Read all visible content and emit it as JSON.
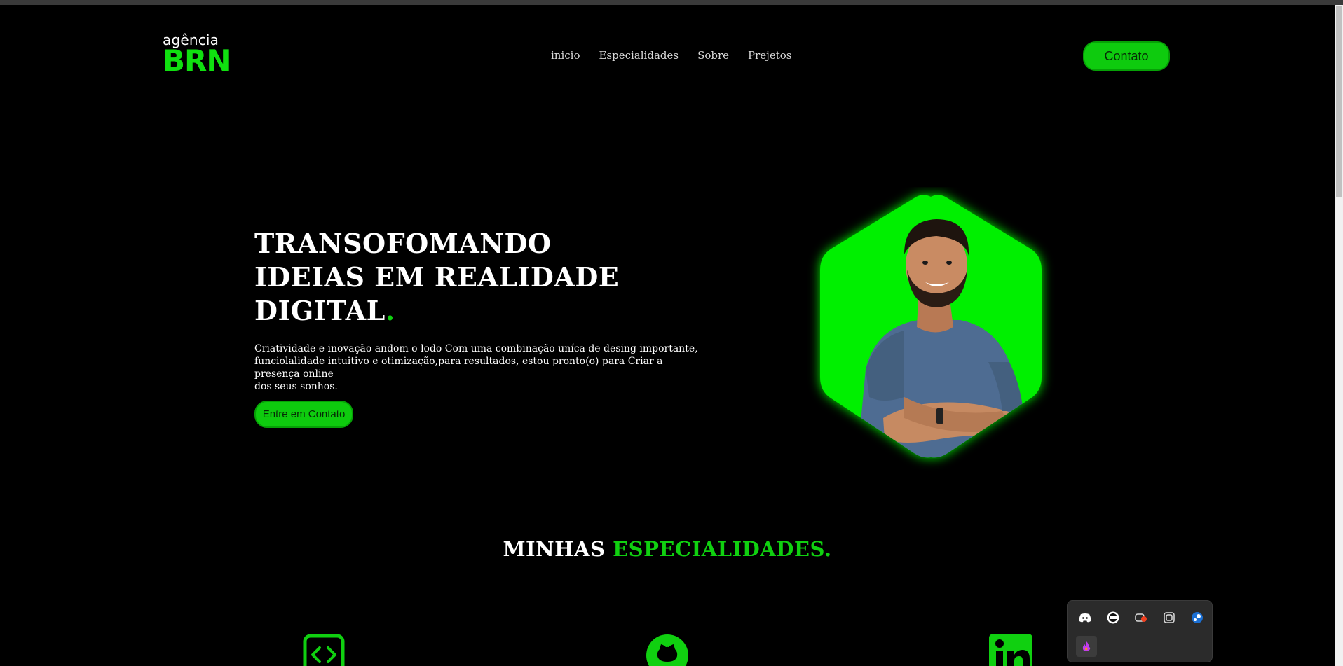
{
  "header": {
    "logo_top": "agência",
    "logo_main": "BRN",
    "nav": [
      "inicio",
      "Especialidades",
      "Sobre",
      "Prejetos"
    ],
    "contact_button": "Contato"
  },
  "hero": {
    "title_lines": [
      "TRANSOFOMANDO",
      "IDEIAS EM REALIDADE",
      "DIGITAL"
    ],
    "title_dot": ".",
    "text_lines": [
      "Criatividade e inovação andom o lodo Com uma combinação uníca de desing importante,",
      "funciolalidade intuitivo e otimização,para resultados, estou pronto(o) para Criar a presença online",
      "dos seus sonhos."
    ],
    "cta": "Entre em Contato",
    "image_icon": "portrait-hexagon"
  },
  "section": {
    "title_white": "MINHAS",
    "title_green": "ESPECIALIDADES."
  },
  "specialties_icons": [
    "code-icon",
    "github-icon",
    "linkedin-icon"
  ],
  "tray_icons": [
    "discord-icon",
    "nvidia-icon",
    "recorder-icon",
    "copilot-icon",
    "steam-icon",
    "app-flame-icon"
  ],
  "colors": {
    "accent": "#10d010",
    "button": "#0ecb0e",
    "background": "#000000"
  }
}
